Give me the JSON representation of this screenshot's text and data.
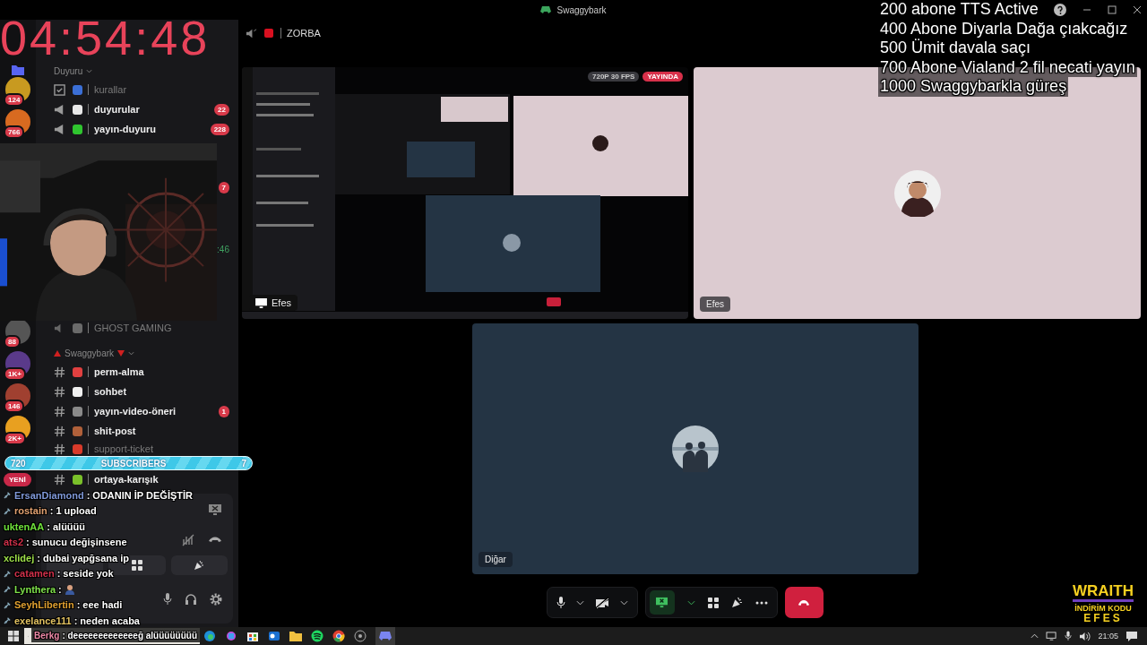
{
  "title_bar": {
    "title": "Swaggybark"
  },
  "timer": "04:54:48",
  "goals": [
    "200 abone TTS Active",
    "400 Abone Diyarla Dağa çıakcağız",
    "500 Ümit davala saçı",
    "700 Abone Vialand 2 fil necati yayın",
    "1000 Swaggybarkla güreş"
  ],
  "server_rail": [
    {
      "badge": "124"
    },
    {
      "badge": "766"
    },
    {
      "badge": "88"
    },
    {
      "badge": "1K+"
    },
    {
      "badge": "146"
    },
    {
      "badge": "2K+"
    }
  ],
  "top_category": {
    "name": "Duyuru",
    "channels": [
      {
        "name": "kurallar",
        "kind": "rules",
        "unread": false,
        "color": "#3b6fd6"
      },
      {
        "name": "duyurular",
        "kind": "announcement",
        "unread": true,
        "color": "#e8e8e8",
        "badge": "22"
      },
      {
        "name": "yayın-duyuru",
        "kind": "announcement",
        "unread": true,
        "color": "#2fc52f",
        "badge": "228"
      }
    ]
  },
  "covered_row_badge": "7",
  "covered_row_time": ":46",
  "voice_channel": {
    "name": "GHOST GAMING",
    "kind": "voice",
    "unread": false,
    "color": "#6a6a6a"
  },
  "bottom_category": {
    "name": "Swaggybark",
    "channels": [
      {
        "name": "perm-alma",
        "kind": "text",
        "unread": true,
        "color": "#e04040"
      },
      {
        "name": "sohbet",
        "kind": "text",
        "unread": true,
        "color": "#f0f0f0"
      },
      {
        "name": "yayın-video-öneri",
        "kind": "text",
        "unread": true,
        "color": "#8a8a8a",
        "badge": "1"
      },
      {
        "name": "shit-post",
        "kind": "text",
        "unread": true,
        "color": "#b0603a"
      },
      {
        "name": "support-ticket",
        "kind": "text",
        "unread": false,
        "color": "#d83a2a"
      },
      {
        "name": "ortaya-karışık",
        "kind": "text",
        "unread": true,
        "color": "#7ac02a"
      }
    ]
  },
  "channel_header": {
    "name": "ZORBA"
  },
  "stream_badges": {
    "quality": "720P 30 FPS",
    "live": "YAYINDA"
  },
  "tiles": [
    {
      "kind": "screen",
      "name": "Efes"
    },
    {
      "kind": "camera",
      "name": "Efes"
    },
    {
      "kind": "camera",
      "name": "Diğar"
    }
  ],
  "subscriber_goal": {
    "current": "720",
    "label": "SUBSCRIBERS",
    "target": "7"
  },
  "new_badge": "YENİ",
  "chat": [
    {
      "user": "ErsanDiamond",
      "color": "#7f98d8",
      "message": ": ODANIN İP DEĞİŞTİR",
      "badge": true
    },
    {
      "user": "rostain",
      "color": "#e0a070",
      "message": ": 1 upload",
      "badge": true
    },
    {
      "user": "uktenAA",
      "color": "#6ee03a",
      "message": ": alüüüü",
      "badge": false
    },
    {
      "user": "ats2",
      "color": "#d0304a",
      "message": ": sunucu değişinsene",
      "badge": false
    },
    {
      "user": "xclidej",
      "color": "#9ee04a",
      "message": ": dubai yapğsana ip",
      "badge": false
    },
    {
      "user": "catamen",
      "color": "#d0304a",
      "message": ": seside yok",
      "badge": true
    },
    {
      "user": "Lynthera",
      "color": "#7ee04a",
      "message": ":",
      "badge": true
    },
    {
      "user": "SeyhLibertin",
      "color": "#e0a030",
      "message": ": eee hadi",
      "badge": true
    },
    {
      "user": "exelance111",
      "color": "#e0c060",
      "message": ": neden acaba",
      "badge": true
    },
    {
      "user": "Berkg",
      "color": "#f08aa8",
      "message": ": deeeeeeeeeeeeeğ alüüüüüüüü",
      "badge": false
    }
  ],
  "sponsor": {
    "brand": "WRAITH",
    "line": "İNDİRİM KODU",
    "code": "EFES"
  },
  "taskbar": {
    "time": "21:05"
  }
}
